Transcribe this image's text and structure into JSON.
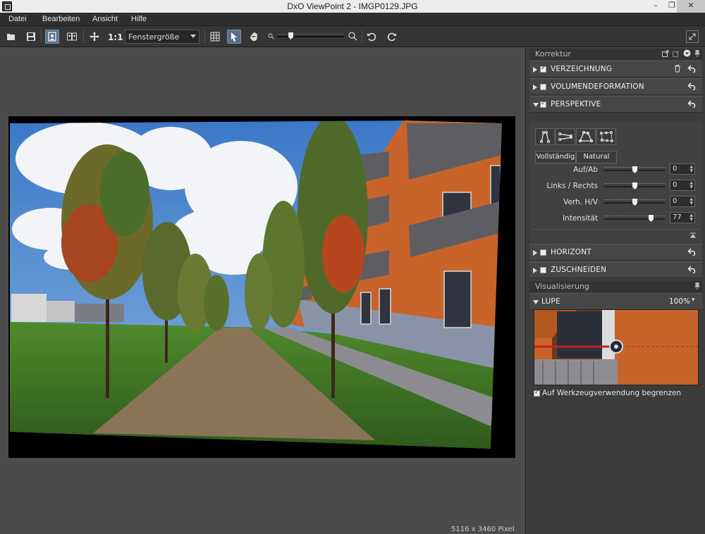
{
  "window": {
    "title": "DxO ViewPoint 2 - IMGP0129.JPG",
    "minimize": "–",
    "restore": "❐",
    "close": "✕"
  },
  "menu": [
    "Datei",
    "Bearbeiten",
    "Ansicht",
    "Hilfe"
  ],
  "toolbar": {
    "one_to_one": "1:1",
    "zoom_select": "Fenstergröße",
    "zoom_level": 0.2
  },
  "canvas": {
    "pixel_info": "5116 x 3460 Pixel"
  },
  "panel": {
    "correction_header": "Korrektur",
    "sections": {
      "verzeichnung": {
        "label": "VERZEICHNUNG",
        "checked": true
      },
      "volumen": {
        "label": "VOLUMENDEFORMATION",
        "checked": false
      },
      "perspektive": {
        "label": "PERSPEKTIVE",
        "checked": true
      },
      "horizont": {
        "label": "HORIZONT",
        "checked": false
      },
      "zuschneiden": {
        "label": "ZUSCHNEIDEN",
        "checked": false
      }
    },
    "perspective": {
      "mode_full": "Vollständig",
      "mode_natural": "Natural",
      "params": [
        {
          "label": "Auf/Ab",
          "value": "0",
          "fraction": 0.5
        },
        {
          "label": "Links / Rechts",
          "value": "0",
          "fraction": 0.5
        },
        {
          "label": "Verh. H/V",
          "value": "0",
          "fraction": 0.5
        },
        {
          "label": "Intensität",
          "value": "77",
          "fraction": 0.77
        }
      ]
    },
    "visualization_header": "Visualisierung",
    "loupe": {
      "label": "LUPE",
      "zoom": "100%",
      "zoom_arrow": "▾",
      "limit_label": "Auf Werkzeugverwendung begrenzen",
      "limit_checked": true
    }
  },
  "colors": {
    "accent_active": "#5a6f8a",
    "facade": "#c8642a"
  }
}
